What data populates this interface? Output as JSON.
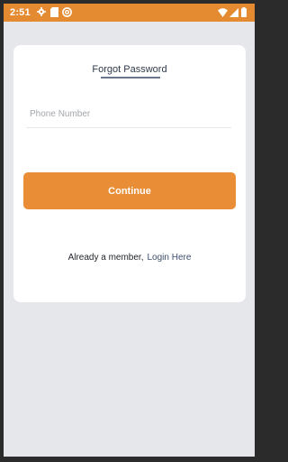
{
  "status_bar": {
    "time": "2:51",
    "background": "#e48a30",
    "left_icons": [
      "gear-icon",
      "sim-card-icon",
      "at-sign-icon"
    ],
    "right_icons": [
      "wifi-icon",
      "signal-icon",
      "battery-icon"
    ]
  },
  "card": {
    "tab_title": "Forgot Password",
    "phone_field": {
      "placeholder": "Phone Number",
      "value": ""
    },
    "continue_label": "Continue",
    "member_text": "Already a member,",
    "login_link": "Login Here"
  },
  "colors": {
    "accent": "#e98d37",
    "page_background": "#e5e7ea",
    "card_background": "#ffffff",
    "link": "#3f4f6e"
  }
}
